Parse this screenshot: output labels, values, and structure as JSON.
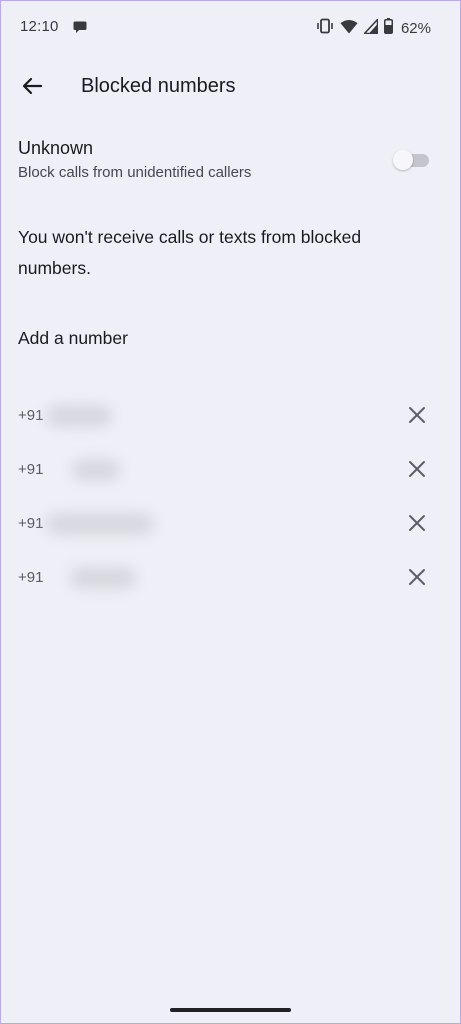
{
  "status_bar": {
    "time": "12:10",
    "battery": "62%",
    "icons": [
      "message-icon",
      "vibrate-icon",
      "wifi-icon",
      "cell-signal-icon",
      "battery-icon"
    ]
  },
  "app_bar": {
    "title": "Blocked numbers",
    "back_icon": "back-arrow-icon"
  },
  "unknown_setting": {
    "title": "Unknown",
    "subtitle": "Block calls from unidentified callers",
    "enabled": false
  },
  "info_text": "You won't receive calls or texts from blocked numbers.",
  "add_number_label": "Add a number",
  "blocked_numbers": [
    {
      "prefix": "+91"
    },
    {
      "prefix": "+91"
    },
    {
      "prefix": "+91"
    },
    {
      "prefix": "+91"
    }
  ],
  "colors": {
    "background": "#eff0f7",
    "text_primary": "#1b1b1f",
    "text_secondary": "#46464f",
    "icon": "#5e5e66"
  }
}
